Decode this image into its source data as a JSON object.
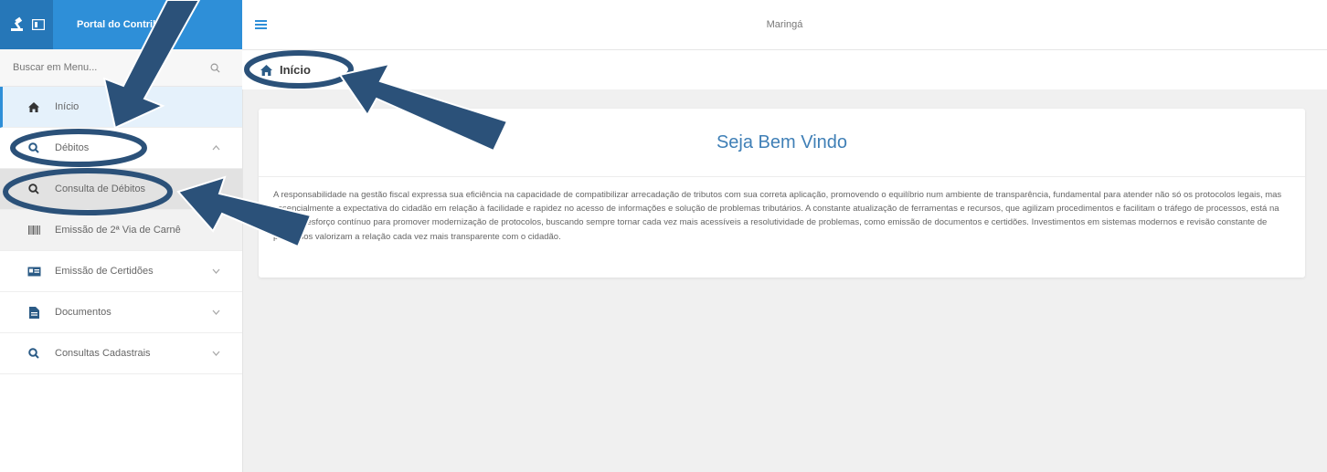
{
  "header": {
    "portal_title": "Portal do Contribuinte",
    "city": "Maringá",
    "icons": {
      "logo": "gavel-icon",
      "toggle": "sidebar-toggle-icon",
      "menu": "hamburger-icon"
    }
  },
  "search": {
    "placeholder": "Buscar em Menu..."
  },
  "sidebar": {
    "items": [
      {
        "label": "Início",
        "icon": "home-icon"
      },
      {
        "label": "Débitos",
        "icon": "search-icon"
      },
      {
        "label": "Consulta de Débitos",
        "icon": "search-icon"
      },
      {
        "label": "Emissão de 2ª Via de Carnê",
        "icon": "barcode-icon"
      },
      {
        "label": "Emissão de Certidões",
        "icon": "id-card-icon"
      },
      {
        "label": "Documentos",
        "icon": "file-icon"
      },
      {
        "label": "Consultas Cadastrais",
        "icon": "search-icon"
      }
    ]
  },
  "breadcrumb": {
    "label": "Início"
  },
  "welcome": {
    "title": "Seja Bem Vindo",
    "text": "A responsabilidade na gestão fiscal expressa sua eficiência na capacidade de compatibilizar arrecadação de tributos com sua correta aplicação, promovendo o equilíbrio num ambiente de transparência, fundamental para atender não só os protocolos legais, mas essencialmente a expectativa do cidadão em relação à facilidade e rapidez no acesso de informações e solução de problemas tributários. A constante atualização de ferramentas e recursos, que agilizam procedimentos e facilitam o tráfego de processos, está na base do esforço contínuo para promover modernização de protocolos, buscando sempre tornar cada vez mais acessíveis a resolutividade de problemas, como emissão de documentos e certidões. Investimentos em sistemas modernos e revisão constante de processos valorizam a relação cada vez mais transparente com o cidadão."
  },
  "colors": {
    "accent": "#2e8fd8",
    "arrow": "#2b5179",
    "title": "#3f7fb6"
  }
}
